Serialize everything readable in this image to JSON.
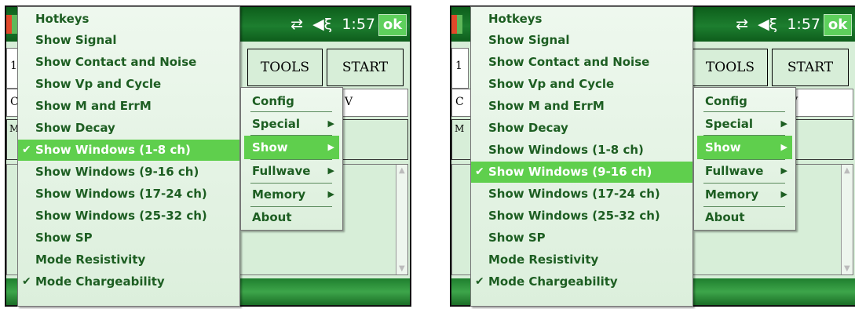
{
  "status": {
    "time": "1:57",
    "ok_label": "ok"
  },
  "buttons": {
    "tools": "TOOLS",
    "start": "START"
  },
  "bg_letters": {
    "top": "1",
    "mid": "C",
    "mid_right": "V",
    "panel": "M"
  },
  "hotkey_menu": {
    "items": [
      "Hotkeys",
      "Show Signal",
      "Show Contact and Noise",
      "Show Vp and Cycle",
      "Show M and ErrM",
      "Show Decay",
      "Show Windows (1-8 ch)",
      "Show Windows (9-16 ch)",
      "Show Windows (17-24 ch)",
      "Show Windows (25-32 ch)",
      "Show SP",
      "Mode Resistivity",
      "Mode Chargeability"
    ]
  },
  "main_menu": {
    "items": [
      "Config",
      "Special",
      "Show",
      "Fullwave",
      "Memory",
      "About"
    ]
  },
  "screens": [
    {
      "selected_hotkey": "Show Windows (1-8 ch)",
      "checked": [
        "Show Windows (1-8 ch)",
        "Mode Chargeability"
      ]
    },
    {
      "selected_hotkey": "Show Windows (9-16 ch)",
      "checked": [
        "Show Windows (9-16 ch)",
        "Mode Chargeability"
      ]
    }
  ],
  "selected_main_menu": "Show",
  "colors": {
    "titlebar": "#1d7e2f",
    "highlight": "#5fcf4d",
    "menu_text": "#1d5e22",
    "background": "#d7eed8"
  }
}
